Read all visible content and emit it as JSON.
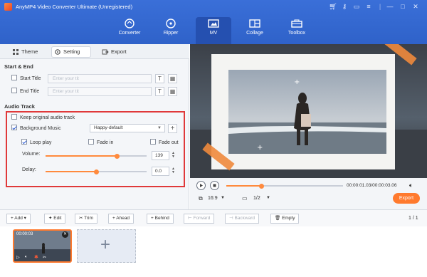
{
  "app": {
    "title": "AnyMP4 Video Converter Ultimate (Unregistered)"
  },
  "nav": [
    {
      "label": "Converter",
      "icon": "converter-icon"
    },
    {
      "label": "Ripper",
      "icon": "ripper-icon"
    },
    {
      "label": "MV",
      "icon": "mv-icon",
      "active": true
    },
    {
      "label": "Collage",
      "icon": "collage-icon"
    },
    {
      "label": "Toolbox",
      "icon": "toolbox-icon"
    }
  ],
  "tabs": {
    "theme": "Theme",
    "setting": "Setting",
    "export": "Export"
  },
  "start_end": {
    "heading": "Start & End",
    "start_title_label": "Start Title",
    "start_title_placeholder": "Enter your tit",
    "end_title_label": "End Title",
    "end_title_placeholder": "Enter your tit",
    "font_button": "T"
  },
  "audio": {
    "heading": "Audio Track",
    "keep_original_label": "Keep original audio track",
    "keep_original_checked": false,
    "background_music_label": "Background Music",
    "background_music_checked": true,
    "music_select": "Happy-default",
    "add_button": "+",
    "loop_label": "Loop play",
    "loop_checked": true,
    "fade_in_label": "Fade in",
    "fade_in_checked": false,
    "fade_out_label": "Fade out",
    "fade_out_checked": false,
    "volume_label": "Volume:",
    "volume_value": "139",
    "volume_fraction": 0.71,
    "delay_label": "Delay:",
    "delay_value": "0.0",
    "delay_fraction": 0.5
  },
  "player": {
    "time": "00:00:01.03/00:00:03.06",
    "progress_fraction": 0.3,
    "aspect": "16:9",
    "page": "1/2",
    "export_label": "Export"
  },
  "toolbar": {
    "add": "Add",
    "edit": "Edit",
    "trim": "Trim",
    "ahead": "Ahead",
    "behind": "Behind",
    "forward": "Forward",
    "backward": "Backward",
    "empty": "Empty",
    "page_count": "1 / 1"
  },
  "clip": {
    "duration": "00:00:03"
  },
  "colors": {
    "accent": "#ff7a2e",
    "header": "#2f62c9",
    "highlight_box": "#e0393a"
  }
}
